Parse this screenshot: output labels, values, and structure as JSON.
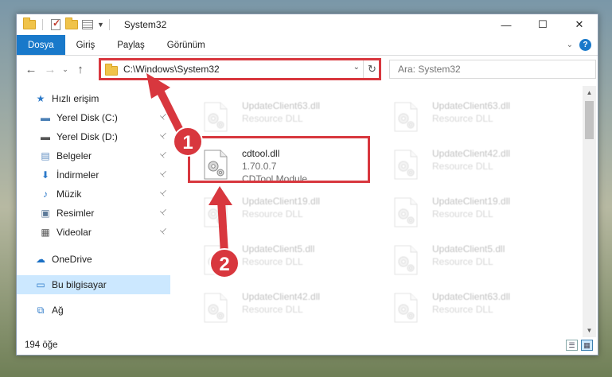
{
  "window": {
    "title": "System32",
    "caption": {
      "minimize": "—",
      "maximize": "☐",
      "close": "✕"
    }
  },
  "ribbon": {
    "tabs": [
      "Dosya",
      "Giriş",
      "Paylaş",
      "Görünüm"
    ],
    "active_tab": "Dosya",
    "help_label": "?",
    "collapse_glyph": "⌄"
  },
  "nav": {
    "back": "←",
    "forward": "→",
    "recent": "⌄",
    "up": "↑",
    "address": "C:\\Windows\\System32",
    "address_dropdown": "⌄",
    "refresh": "↻",
    "search_placeholder": "Ara: System32",
    "search_icon": "⌕"
  },
  "sidebar": {
    "items": [
      {
        "label": "Hızlı erişim",
        "icon": "star-icon",
        "glyph": "★",
        "color": "#2b79c9",
        "pinned": false
      },
      {
        "label": "Yerel Disk (C:)",
        "icon": "drive-c-icon",
        "glyph": "▬",
        "color": "#4a7fb5",
        "pinned": true
      },
      {
        "label": "Yerel Disk (D:)",
        "icon": "drive-d-icon",
        "glyph": "▬",
        "color": "#555555",
        "pinned": true
      },
      {
        "label": "Belgeler",
        "icon": "documents-icon",
        "glyph": "▤",
        "color": "#5d8bc0",
        "pinned": true
      },
      {
        "label": "İndirmeler",
        "icon": "downloads-icon",
        "glyph": "⬇",
        "color": "#2b79c9",
        "pinned": true
      },
      {
        "label": "Müzik",
        "icon": "music-icon",
        "glyph": "♪",
        "color": "#2b79c9",
        "pinned": true
      },
      {
        "label": "Resimler",
        "icon": "pictures-icon",
        "glyph": "▣",
        "color": "#5c7a99",
        "pinned": true
      },
      {
        "label": "Videolar",
        "icon": "videos-icon",
        "glyph": "▦",
        "color": "#555555",
        "pinned": true
      },
      {
        "label": "OneDrive",
        "icon": "onedrive-icon",
        "glyph": "☁",
        "color": "#1a6fc4",
        "pinned": false
      },
      {
        "label": "Bu bilgisayar",
        "icon": "computer-icon",
        "glyph": "▭",
        "color": "#2b79c9",
        "pinned": false,
        "selected": true
      },
      {
        "label": "Ağ",
        "icon": "network-icon",
        "glyph": "⧉",
        "color": "#2b79c9",
        "pinned": false
      }
    ],
    "pin_glyph": "📌"
  },
  "files": {
    "highlighted": {
      "name": "cdtool.dll",
      "version": "1.70.0.7",
      "description": "CDTool Module"
    },
    "faded": [
      {
        "name": "UpdateClient63.dll",
        "type": "Resource DLL"
      },
      {
        "name": "UpdateClient63.dll",
        "type": "Resource DLL"
      },
      {
        "name": "UpdateClient42.dll",
        "type": "Resource DLL"
      },
      {
        "name": "UpdateClient19.dll",
        "type": "Resource DLL"
      },
      {
        "name": "UpdateClient19.dll",
        "type": "Resource DLL"
      },
      {
        "name": "UpdateClient5.dll",
        "type": "Resource DLL"
      },
      {
        "name": "UpdateClient5.dll",
        "type": "Resource DLL"
      },
      {
        "name": "UpdateClient42.dll",
        "type": "Resource DLL"
      },
      {
        "name": "UpdateClient63.dll",
        "type": "Resource DLL"
      }
    ]
  },
  "scrollbar": {
    "up": "▲",
    "down": "▼"
  },
  "status": {
    "count": "194 öğe",
    "details_view": "☰",
    "tiles_view": "▦"
  },
  "annotations": {
    "step1": "1",
    "step2": "2",
    "color": "#d8373e"
  }
}
